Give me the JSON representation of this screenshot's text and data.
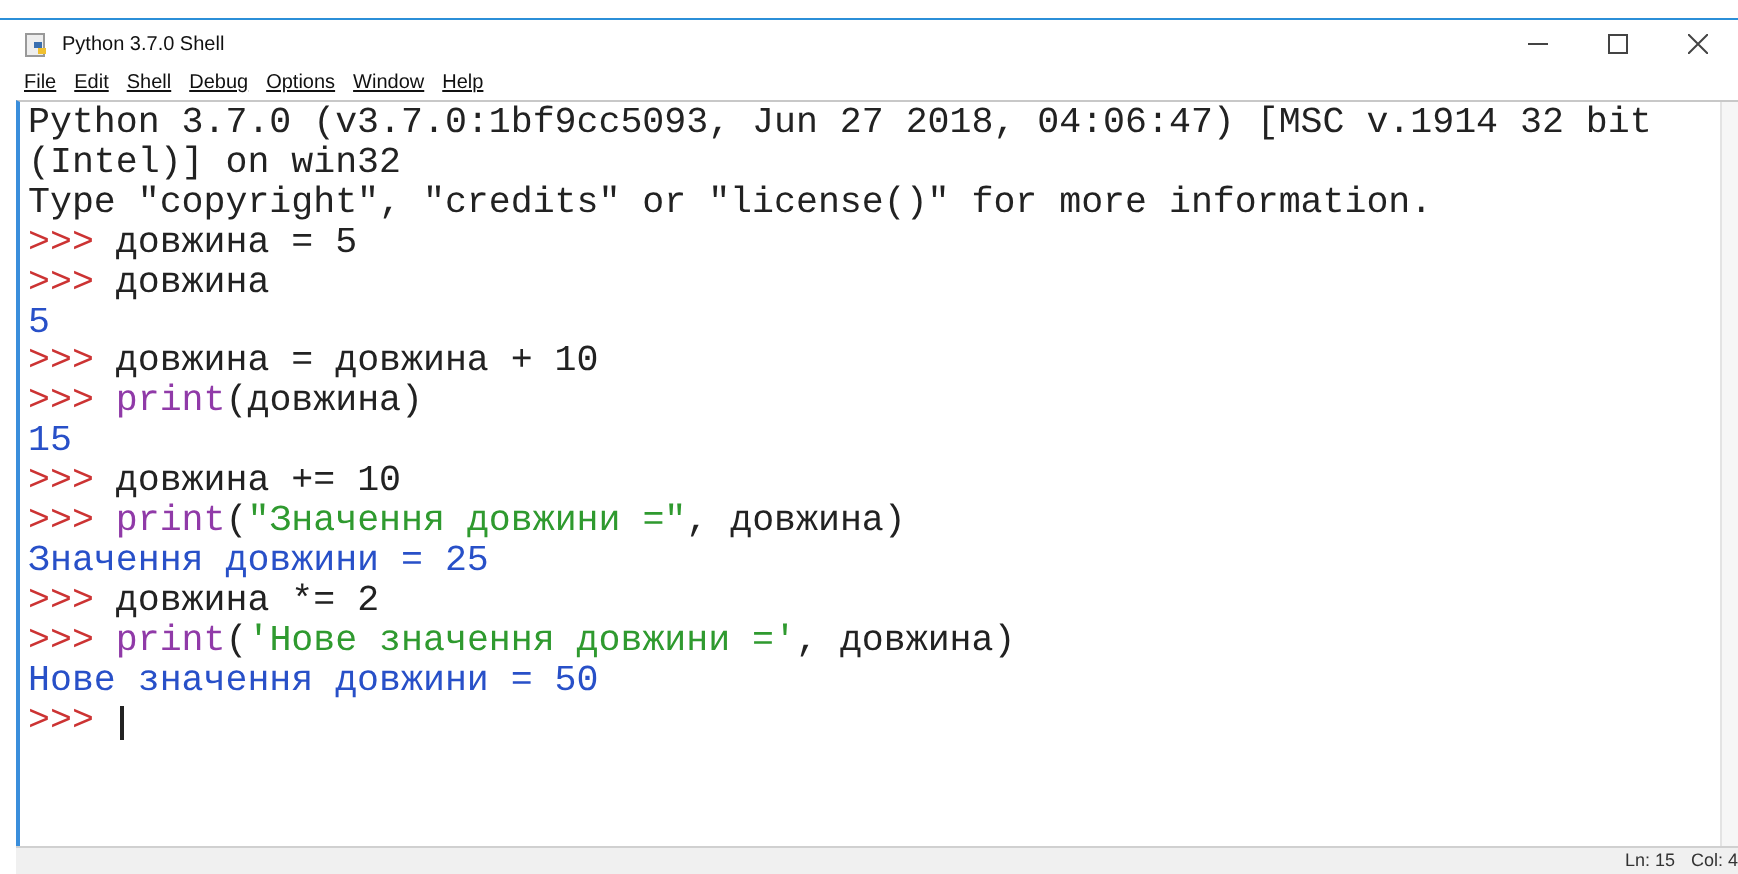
{
  "window": {
    "title": "Python 3.7.0 Shell"
  },
  "menu": [
    "File",
    "Edit",
    "Shell",
    "Debug",
    "Options",
    "Window",
    "Help"
  ],
  "lines": [
    {
      "segments": [
        {
          "kind": "plain",
          "text": "Python 3.7.0 (v3.7.0:1bf9cc5093, Jun 27 2018, 04:06:47) [MSC v.1914 32 bit"
        }
      ]
    },
    {
      "segments": [
        {
          "kind": "plain",
          "text": "(Intel)] on win32"
        }
      ]
    },
    {
      "segments": [
        {
          "kind": "plain",
          "text": "Type \"copyright\", \"credits\" or \"license()\" for more information."
        }
      ]
    },
    {
      "segments": [
        {
          "kind": "prompt",
          "text": ">>> "
        },
        {
          "kind": "plain",
          "text": "довжина = 5"
        }
      ]
    },
    {
      "segments": [
        {
          "kind": "prompt",
          "text": ">>> "
        },
        {
          "kind": "plain",
          "text": "довжина"
        }
      ]
    },
    {
      "segments": [
        {
          "kind": "output",
          "text": "5"
        }
      ]
    },
    {
      "segments": [
        {
          "kind": "prompt",
          "text": ">>> "
        },
        {
          "kind": "plain",
          "text": "довжина = довжина + 10"
        }
      ]
    },
    {
      "segments": [
        {
          "kind": "prompt",
          "text": ">>> "
        },
        {
          "kind": "builtin",
          "text": "print"
        },
        {
          "kind": "plain",
          "text": "(довжина)"
        }
      ]
    },
    {
      "segments": [
        {
          "kind": "output",
          "text": "15"
        }
      ]
    },
    {
      "segments": [
        {
          "kind": "prompt",
          "text": ">>> "
        },
        {
          "kind": "plain",
          "text": "довжина += 10"
        }
      ]
    },
    {
      "segments": [
        {
          "kind": "prompt",
          "text": ">>> "
        },
        {
          "kind": "builtin",
          "text": "print"
        },
        {
          "kind": "plain",
          "text": "("
        },
        {
          "kind": "string",
          "text": "\"Значення довжини =\""
        },
        {
          "kind": "plain",
          "text": ", довжина)"
        }
      ]
    },
    {
      "segments": [
        {
          "kind": "output",
          "text": "Значення довжини = 25"
        }
      ]
    },
    {
      "segments": [
        {
          "kind": "prompt",
          "text": ">>> "
        },
        {
          "kind": "plain",
          "text": "довжина *= 2"
        }
      ]
    },
    {
      "segments": [
        {
          "kind": "prompt",
          "text": ">>> "
        },
        {
          "kind": "builtin",
          "text": "print"
        },
        {
          "kind": "plain",
          "text": "("
        },
        {
          "kind": "string",
          "text": "'Нове значення довжини ='"
        },
        {
          "kind": "plain",
          "text": ", довжина)"
        }
      ]
    },
    {
      "segments": [
        {
          "kind": "output",
          "text": "Нове значення довжини = 50"
        }
      ]
    },
    {
      "segments": [
        {
          "kind": "prompt",
          "text": ">>> "
        }
      ],
      "cursor": true
    }
  ],
  "status_bar": [
    "Ln: 15",
    "Col: 4"
  ]
}
